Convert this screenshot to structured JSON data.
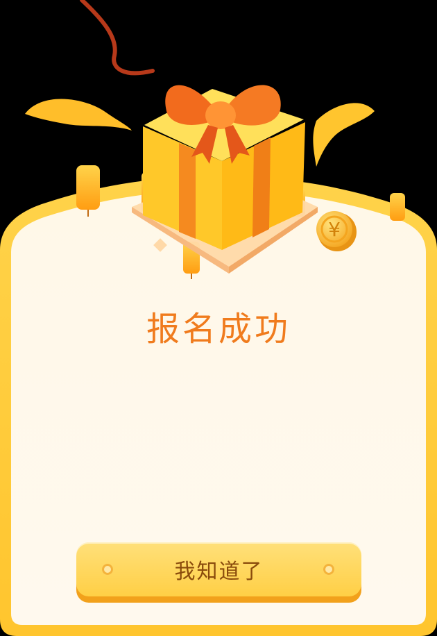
{
  "dialog": {
    "title": "报名成功",
    "button_label": "我知道了"
  },
  "decorations": {
    "coin_symbol": "¥",
    "gift_icon": "gift-box-icon",
    "coin_icon": "yen-coin-icon",
    "ribbon_icon": "ribbon-streamer-icon"
  },
  "colors": {
    "background": "#000000",
    "card_fill": "#fff8ea",
    "card_border": "#ffc93a",
    "title": "#f07b1d",
    "button_top": "#ffe07a",
    "button_bottom": "#ffcf45",
    "button_text": "#8a4b0c"
  }
}
